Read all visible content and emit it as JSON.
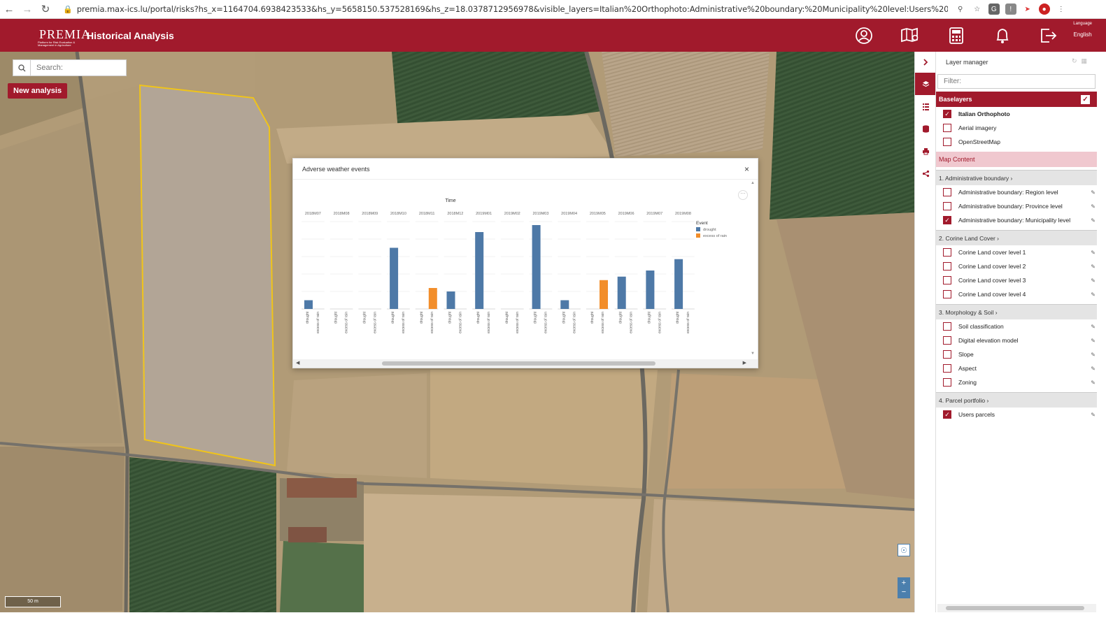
{
  "browser": {
    "url": "premia.max-ics.lu/portal/risks?hs_x=1164704.6938423533&hs_y=5658150.537528169&hs_z=18.0378712956978&visible_layers=Italian%20Orthophoto:Administrative%20boundary:%20Municipality%20level:Users%20parcels&hs_panel=layermana..."
  },
  "header": {
    "logo_text": "PREMIA",
    "logo_subtext": "Platform for Risk Evaluation & Management in Agriculture",
    "title": "Historical Analysis",
    "language_label": "Language",
    "language_value": "English"
  },
  "map": {
    "search_placeholder": "Search:",
    "new_analysis_label": "New analysis",
    "scale_label": "50 m",
    "zoom_in": "+",
    "zoom_out": "−"
  },
  "dialog": {
    "title": "Adverse weather events",
    "close": "×"
  },
  "chart_data": {
    "type": "bar",
    "title": "Time",
    "legend_title": "Event",
    "legend_position": "right",
    "categories": [
      "2018M07",
      "2018M08",
      "2018M09",
      "2018M10",
      "2018M11",
      "2018M12",
      "2019M01",
      "2019M02",
      "2019M03",
      "2019M04",
      "2019M05",
      "2019M06",
      "2019M07",
      "2019M08"
    ],
    "sub_categories": [
      "drought",
      "excess of rain"
    ],
    "series": [
      {
        "name": "drought",
        "color": "#4e79a7",
        "values": [
          1.0,
          0,
          0,
          7.0,
          0,
          2.0,
          8.8,
          0,
          9.6,
          1.0,
          0,
          3.7,
          4.4,
          5.7
        ]
      },
      {
        "name": "excess of rain",
        "color": "#f28e2b",
        "values": [
          0,
          0,
          0,
          0,
          2.4,
          0,
          0,
          0,
          0,
          0,
          3.3,
          0,
          0,
          0
        ]
      }
    ],
    "ylim": [
      0,
      10
    ],
    "grid": true
  },
  "panel": {
    "title": "Layer manager",
    "filter_placeholder": "Filter:",
    "baselayers_label": "Baselayers",
    "baselayers": [
      {
        "label": "Italian Orthophoto",
        "checked": true
      },
      {
        "label": "Aerial imagery",
        "checked": false
      },
      {
        "label": "OpenStreetMap",
        "checked": false
      }
    ],
    "map_content_label": "Map Content",
    "groups": [
      {
        "label": "1. Administrative boundary ›",
        "items": [
          {
            "label": "Administrative boundary: Region level",
            "checked": false
          },
          {
            "label": "Administrative boundary: Province level",
            "checked": false
          },
          {
            "label": "Administrative boundary: Municipality level",
            "checked": true
          }
        ]
      },
      {
        "label": "2. Corine Land Cover ›",
        "items": [
          {
            "label": "Corine Land cover level 1",
            "checked": false
          },
          {
            "label": "Corine Land cover level 2",
            "checked": false
          },
          {
            "label": "Corine Land cover level 3",
            "checked": false
          },
          {
            "label": "Corine Land cover level 4",
            "checked": false
          }
        ]
      },
      {
        "label": "3. Morphology & Soil ›",
        "items": [
          {
            "label": "Soil classification",
            "checked": false
          },
          {
            "label": "Digital elevation model",
            "checked": false
          },
          {
            "label": "Slope",
            "checked": false
          },
          {
            "label": "Aspect",
            "checked": false
          },
          {
            "label": "Zoning",
            "checked": false
          }
        ]
      },
      {
        "label": "4. Parcel portfolio ›",
        "items": [
          {
            "label": "Users parcels",
            "checked": true
          }
        ]
      }
    ]
  },
  "colors": {
    "brand": "#a11a2c",
    "drought": "#4e79a7",
    "excess_of_rain": "#f28e2b",
    "parcel_outline": "#f0c419"
  }
}
